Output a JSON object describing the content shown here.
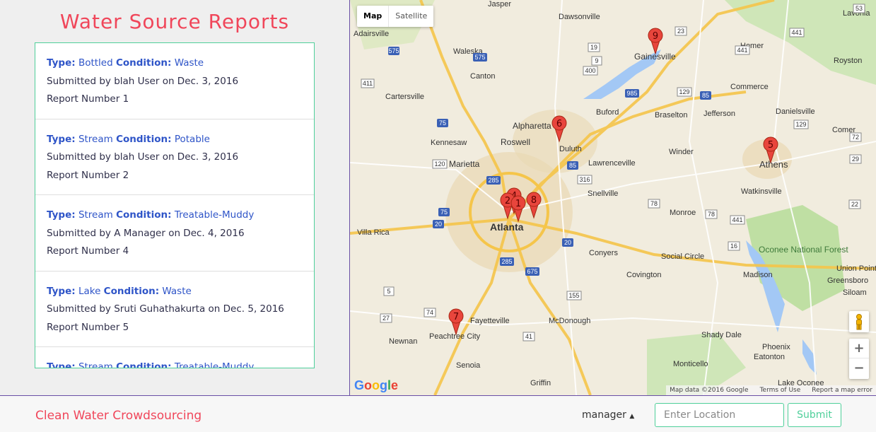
{
  "left_panel": {
    "title": "Water Source Reports",
    "type_key": "Type:",
    "condition_key": "Condition:",
    "reports": [
      {
        "type": "Bottled",
        "condition": "Waste",
        "submitted": "Submitted by blah User on Dec. 3, 2016",
        "number": "Report Number 1"
      },
      {
        "type": "Stream",
        "condition": "Potable",
        "submitted": "Submitted by blah User on Dec. 3, 2016",
        "number": "Report Number 2"
      },
      {
        "type": "Stream",
        "condition": "Treatable-Muddy",
        "submitted": "Submitted by A Manager on Dec. 4, 2016",
        "number": "Report Number 4"
      },
      {
        "type": "Lake",
        "condition": "Waste",
        "submitted": "Submitted by Sruti Guhathakurta on Dec. 5, 2016",
        "number": "Report Number 5"
      },
      {
        "type": "Stream",
        "condition": "Treatable-Muddy",
        "submitted": "",
        "number": ""
      }
    ]
  },
  "map": {
    "type_buttons": {
      "map": "Map",
      "satellite": "Satellite"
    },
    "zoom_in": "+",
    "zoom_out": "−",
    "attribution": {
      "data": "Map data ©2016 Google",
      "terms": "Terms of Use",
      "report": "Report a map error"
    },
    "logo": "Google",
    "markers": [
      "9",
      "6",
      "5",
      "2",
      "4",
      "1",
      "8",
      "7"
    ],
    "places": [
      "Jasper",
      "Dawsonville",
      "Lavonia",
      "Adairsville",
      "Waleska",
      "Gainesville",
      "Homer",
      "Royston",
      "Canton",
      "Commerce",
      "Cartersville",
      "Buford",
      "Braselton",
      "Jefferson",
      "Danielsville",
      "Alpharetta",
      "Comer",
      "Kennesaw",
      "Roswell",
      "Duluth",
      "Winder",
      "Athens",
      "Marietta",
      "Lawrenceville",
      "Snellville",
      "Watkinsville",
      "Monroe",
      "Villa Rica",
      "Atlanta",
      "Conyers",
      "Oconee National Forest",
      "Social Circle",
      "Covington",
      "Madison",
      "Union Point",
      "Greensboro",
      "Siloam",
      "Fayetteville",
      "McDonough",
      "Peachtree City",
      "Shady Dale",
      "Phoenix",
      "Newnan",
      "Senoia",
      "Monticello",
      "Eatonton",
      "Griffin",
      "Lake Oconee"
    ],
    "route_shields": [
      "575",
      "575",
      "411",
      "75",
      "75",
      "285",
      "285",
      "20",
      "20",
      "675",
      "85",
      "85",
      "985",
      "129",
      "129",
      "441",
      "441",
      "441",
      "78",
      "78",
      "316",
      "5",
      "29",
      "19",
      "120",
      "23",
      "155",
      "74",
      "16",
      "41",
      "27",
      "22",
      "72",
      "53",
      "9",
      "400"
    ]
  },
  "footer": {
    "brand": "Clean Water Crowdsourcing",
    "user": "manager",
    "location_placeholder": "Enter Location",
    "submit": "Submit"
  },
  "colors": {
    "accent": "#f0465a",
    "border": "#4fcf9a",
    "link": "#2f55c8",
    "divider": "#6a4fa6"
  }
}
